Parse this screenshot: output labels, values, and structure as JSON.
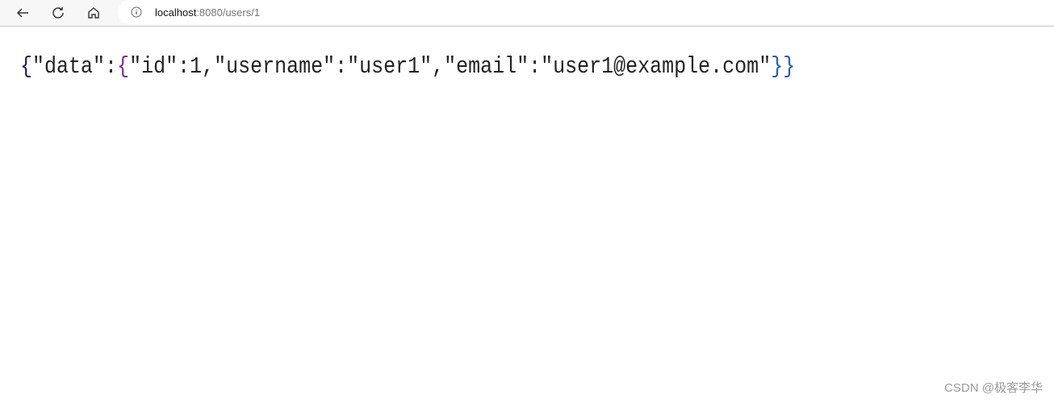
{
  "browser": {
    "url_host": "localhost",
    "url_rest": ":8080/users/1",
    "icons": [
      "back-arrow-icon",
      "reload-icon",
      "home-icon",
      "info-icon"
    ]
  },
  "page": {
    "open_outer": "{",
    "part1": "\"data\":",
    "open_inner": "{",
    "part2": "\"id\":1,\"username\":\"user1\",\"email\":\"user1@example.com\"",
    "close": "}}",
    "brace_colors": {
      "outer_open": "#1a1a5e",
      "inner_open": "#7a2a9a",
      "close": "#2a5ab0"
    }
  },
  "watermark": "CSDN @极客李华"
}
